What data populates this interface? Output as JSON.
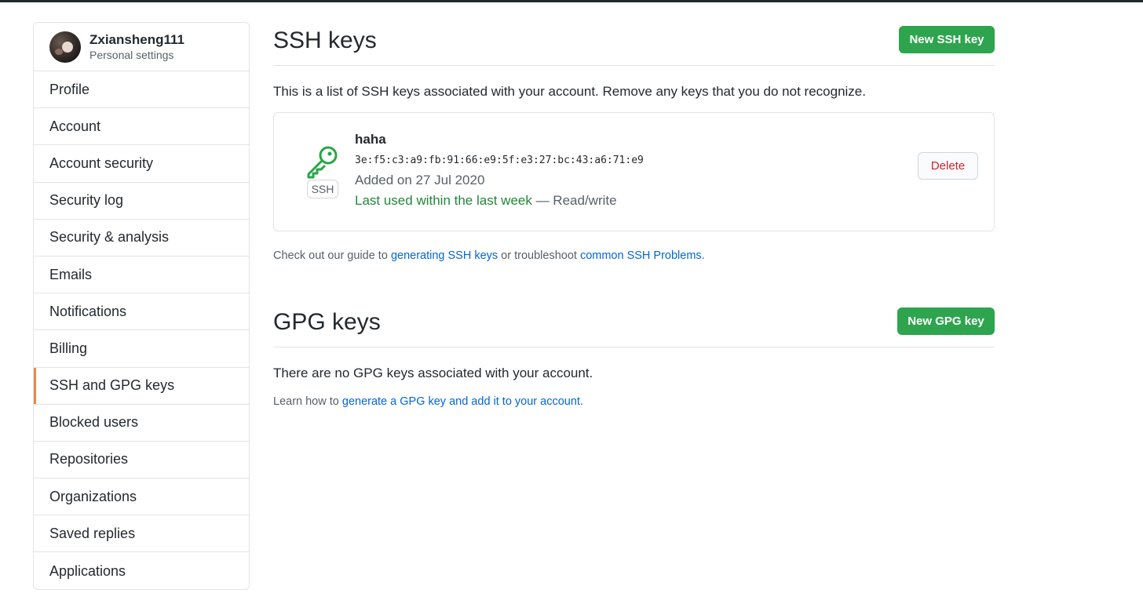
{
  "user": {
    "username": "Zxiansheng111",
    "subtitle": "Personal settings"
  },
  "sidebar": {
    "items": [
      {
        "label": "Profile",
        "selected": false
      },
      {
        "label": "Account",
        "selected": false
      },
      {
        "label": "Account security",
        "selected": false
      },
      {
        "label": "Security log",
        "selected": false
      },
      {
        "label": "Security & analysis",
        "selected": false
      },
      {
        "label": "Emails",
        "selected": false
      },
      {
        "label": "Notifications",
        "selected": false
      },
      {
        "label": "Billing",
        "selected": false
      },
      {
        "label": "SSH and GPG keys",
        "selected": true
      },
      {
        "label": "Blocked users",
        "selected": false
      },
      {
        "label": "Repositories",
        "selected": false
      },
      {
        "label": "Organizations",
        "selected": false
      },
      {
        "label": "Saved replies",
        "selected": false
      },
      {
        "label": "Applications",
        "selected": false
      }
    ]
  },
  "ssh": {
    "title": "SSH keys",
    "new_button": "New SSH key",
    "description": "This is a list of SSH keys associated with your account. Remove any keys that you do not recognize.",
    "key": {
      "icon": "key-icon",
      "badge": "SSH",
      "title": "haha",
      "fingerprint": "3e:f5:c3:a9:fb:91:66:e9:5f:e3:27:bc:43:a6:71:e9",
      "added": "Added on 27 Jul 2020",
      "last_used": "Last used within the last week",
      "access": " — Read/write",
      "delete_label": "Delete"
    },
    "guide": {
      "prefix": "Check out our guide to ",
      "link1": "generating SSH keys",
      "middle": " or troubleshoot ",
      "link2": "common SSH Problems",
      "suffix": "."
    }
  },
  "gpg": {
    "title": "GPG keys",
    "new_button": "New GPG key",
    "empty": "There are no GPG keys associated with your account.",
    "learn": {
      "prefix": "Learn how to ",
      "link": "generate a GPG key and add it to your account",
      "suffix": "."
    }
  },
  "colors": {
    "primary_button": "#2ea44f",
    "selected_indicator": "#e36209",
    "link": "#0366d6",
    "success_text": "#22863a",
    "danger_text": "#cb2431"
  }
}
